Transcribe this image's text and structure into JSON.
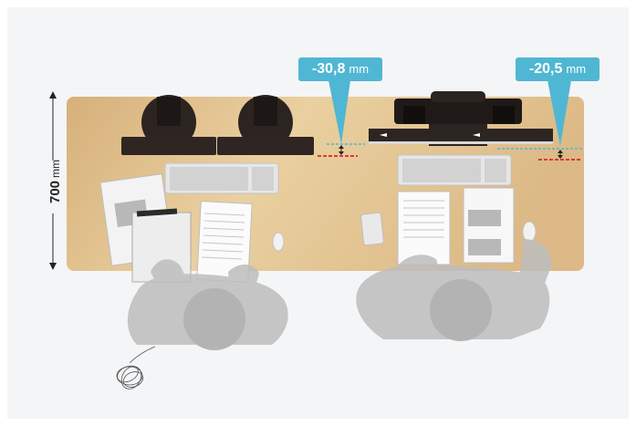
{
  "desk_depth": {
    "value": "700",
    "unit": "mm"
  },
  "callouts": [
    {
      "value": "-30,8",
      "unit": "mm"
    },
    {
      "value": "-20,5",
      "unit": "mm"
    }
  ],
  "colors": {
    "accent": "#4fb7d3",
    "reference_line": "#e0242a",
    "desk": "#e2c08c",
    "person": "#bdbdbd"
  }
}
